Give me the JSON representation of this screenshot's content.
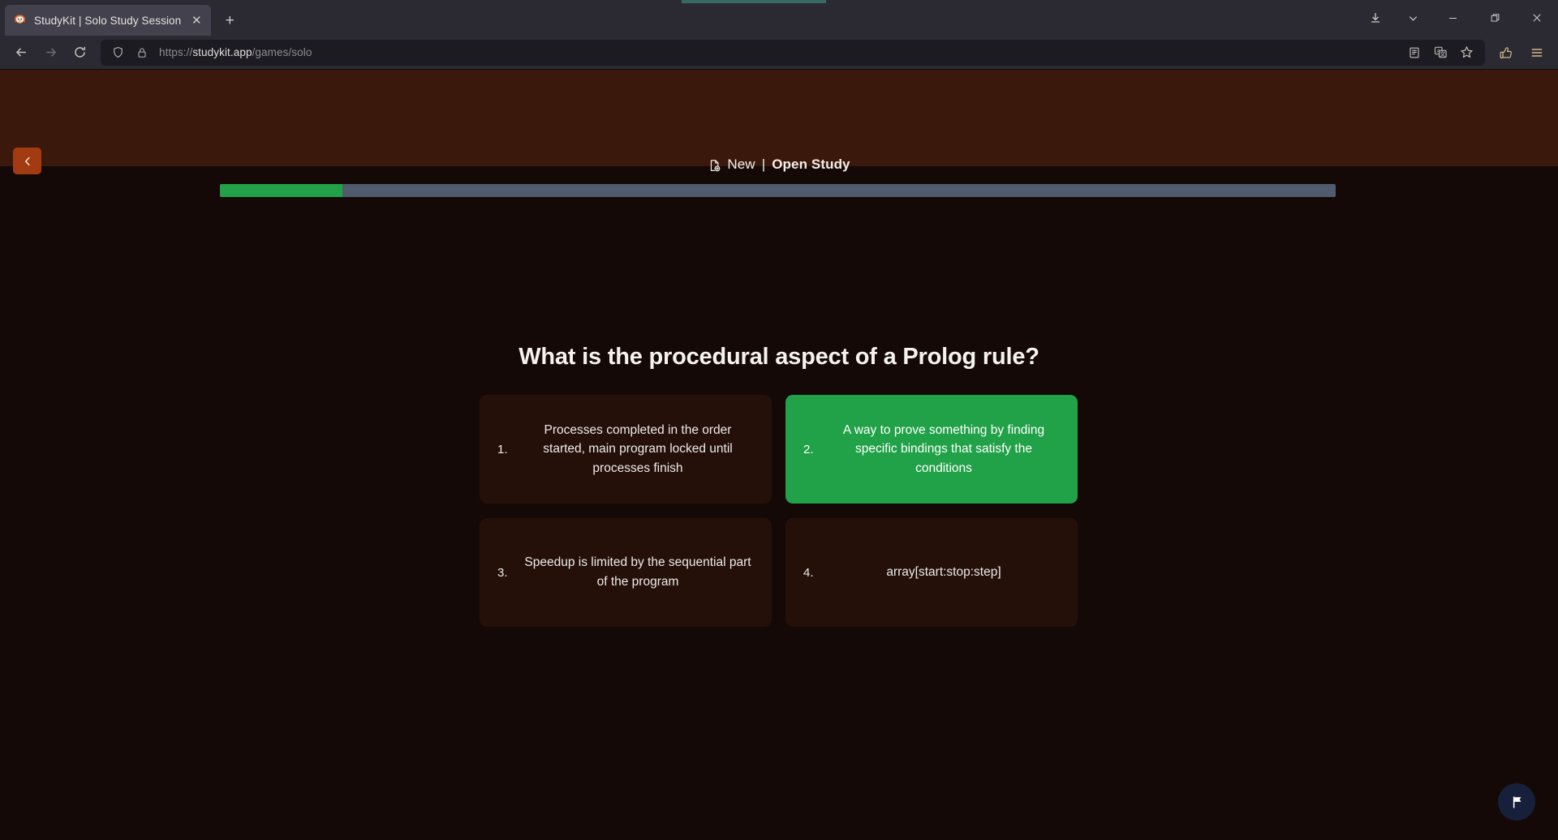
{
  "browser": {
    "tab": {
      "title": "StudyKit | Solo Study Session",
      "favicon_name": "firefox-favicon",
      "close_label": "✕"
    },
    "new_tab_label": "+",
    "nav": {
      "back_label": "←",
      "forward_label": "→",
      "reload_label": "↻"
    },
    "url": {
      "scheme": "https://",
      "host": "studykit.app",
      "path": "/games/solo",
      "full": "https://studykit.app/games/solo",
      "shield_icon": "shield-icon",
      "lock_icon": "lock-icon"
    },
    "toolbar_icons": [
      "reader-mode-icon",
      "translate-icon",
      "bookmark-star-icon",
      "extensions-icon",
      "app-menu-icon"
    ],
    "window_controls": {
      "downloads": "downloads-icon",
      "chevron": "chevron-down-icon",
      "minimize": "—",
      "maximize": "❐",
      "close": "✕"
    }
  },
  "app": {
    "back_button_label": "‹",
    "header": {
      "doc_icon": "document-plus-icon",
      "new_label": "New",
      "separator": "|",
      "mode_label": "Open Study"
    },
    "progress": {
      "percent": 11,
      "fill_color": "#21a148",
      "track_color": "#515b6e"
    },
    "quiz": {
      "question": "What is the procedural aspect of a Prolog rule?",
      "options": [
        {
          "number": "1.",
          "text": "Processes completed in the order started, main program locked until processes finish",
          "selected": false
        },
        {
          "number": "2.",
          "text": "A way to prove something by finding specific bindings that satisfy the conditions",
          "selected": true
        },
        {
          "number": "3.",
          "text": "Speedup is limited by the sequential part of the program",
          "selected": false
        },
        {
          "number": "4.",
          "text": "array[start:stop:step]",
          "selected": false
        }
      ]
    },
    "report_button": {
      "icon": "flag-icon",
      "color": "#17203a"
    },
    "colors": {
      "header_bg": "#3a190c",
      "page_bg": "#140907",
      "card_bg": "#241009",
      "accent_green": "#21a148",
      "back_button_bg": "#a23b12"
    }
  }
}
